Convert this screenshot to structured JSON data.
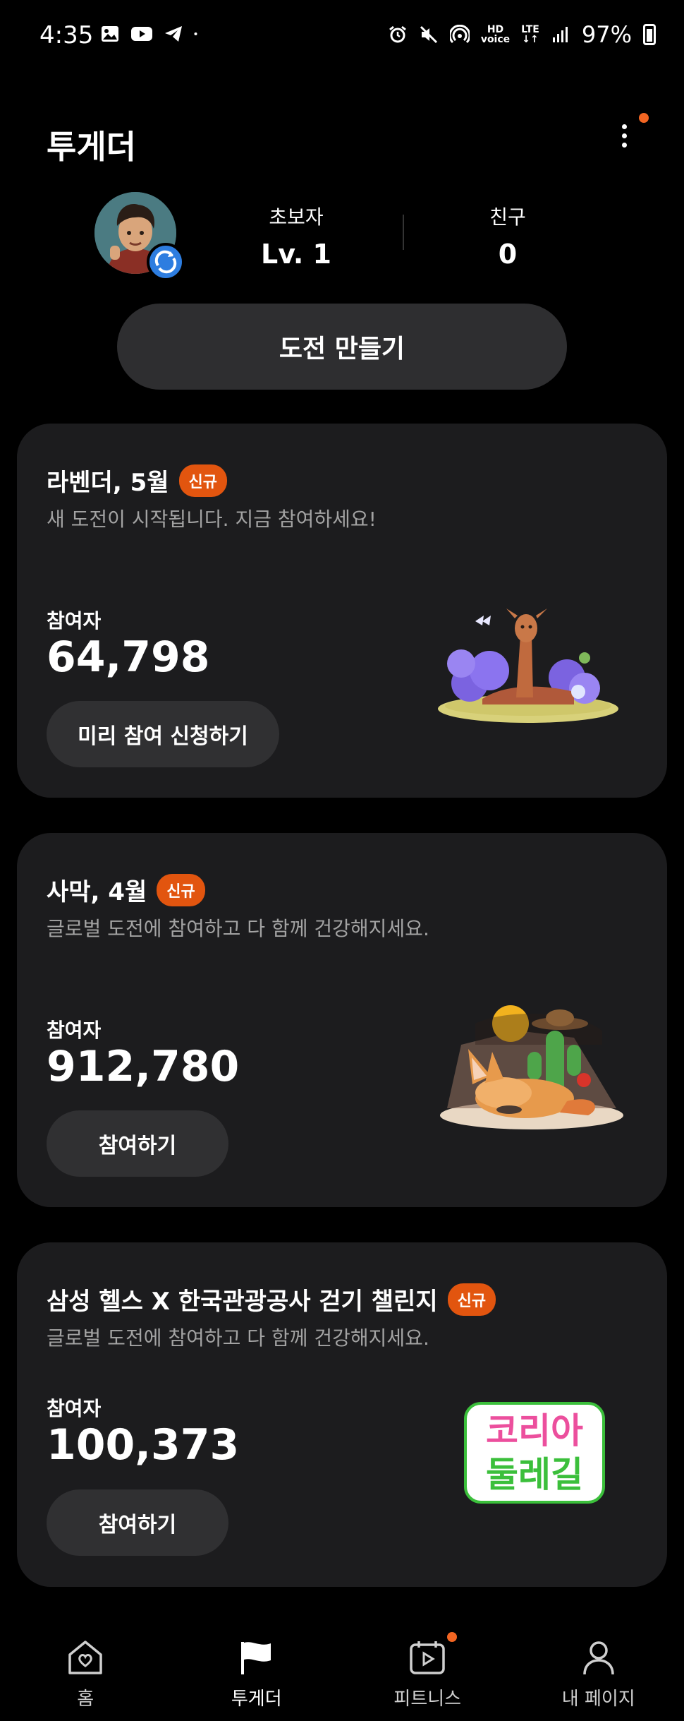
{
  "status_bar": {
    "time": "4:35",
    "battery": "97%",
    "left_icons": [
      "gallery-icon",
      "youtube-icon",
      "telegram-icon",
      "dot-icon"
    ],
    "right_icons": [
      "alarm-icon",
      "mute-icon",
      "hotspot-icon",
      "hd-voice-icon",
      "lte-icon",
      "signal-icon",
      "battery-icon"
    ]
  },
  "header": {
    "title": "투게더"
  },
  "profile": {
    "level_label": "초보자",
    "level_value": "Lv. 1",
    "friends_label": "친구",
    "friends_value": "0"
  },
  "create_button_label": "도전 만들기",
  "cards": [
    {
      "title": "라벤더, 5월",
      "badge": "신규",
      "desc": "새 도전이 시작됩니다. 지금 참여하세요!",
      "participants_label": "참여자",
      "participants": "64,798",
      "button": "미리 참여 신청하기"
    },
    {
      "title": "사막, 4월",
      "badge": "신규",
      "desc": "글로벌 도전에 참여하고 다 함께 건강해지세요.",
      "participants_label": "참여자",
      "participants": "912,780",
      "button": "참여하기"
    },
    {
      "title": "삼성 헬스 X 한국관광공사 걷기 챌린지",
      "badge": "신규",
      "desc": "글로벌 도전에 참여하고 다 함께 건강해지세요.",
      "participants_label": "참여자",
      "participants": "100,373",
      "button": "참여하기",
      "logo_line1": "코리아",
      "logo_line2": "둘레길"
    }
  ],
  "bottom_nav": [
    {
      "label": "홈",
      "icon": "home-heart-icon"
    },
    {
      "label": "투게더",
      "icon": "flag-icon"
    },
    {
      "label": "피트니스",
      "icon": "play-calendar-icon"
    },
    {
      "label": "내 페이지",
      "icon": "person-icon"
    }
  ],
  "colors": {
    "background": "#000000",
    "card": "#1c1c1e",
    "accent": "#e2550f",
    "button": "#2e2e30"
  }
}
